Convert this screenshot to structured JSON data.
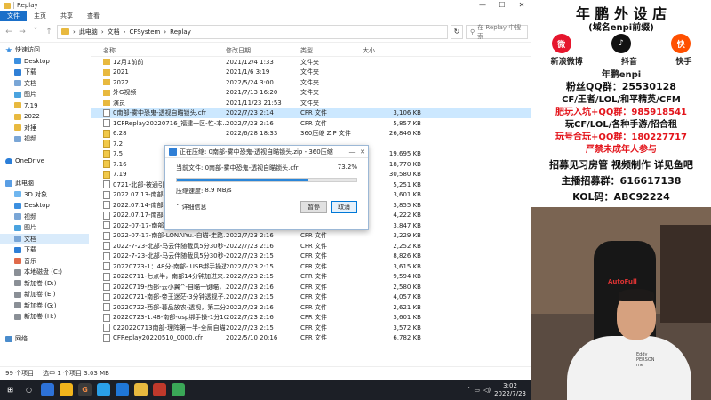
{
  "window": {
    "title": "Replay",
    "controls": [
      "—",
      "☐",
      "✕"
    ]
  },
  "ribbon": {
    "tabs": [
      "文件",
      "主页",
      "共享",
      "查看"
    ]
  },
  "address": {
    "path": [
      "此电脑",
      "文档",
      "CFSystem",
      "Replay"
    ],
    "search_placeholder": "在 Replay 中搜索"
  },
  "nav": [
    {
      "label": "快速访问",
      "icon": "star-icon",
      "indent": 0
    },
    {
      "label": "Desktop",
      "icon": "desktop-icon",
      "indent": 1,
      "pin": true
    },
    {
      "label": "下载",
      "icon": "download-icon",
      "indent": 1,
      "pin": true
    },
    {
      "label": "文档",
      "icon": "document-icon",
      "indent": 1,
      "pin": true
    },
    {
      "label": "图片",
      "icon": "picture-icon",
      "indent": 1,
      "pin": true
    },
    {
      "label": "7.19",
      "icon": "folder-icon",
      "indent": 1
    },
    {
      "label": "2022",
      "icon": "folder-icon",
      "indent": 1
    },
    {
      "label": "对捶",
      "icon": "folder-icon",
      "indent": 1
    },
    {
      "label": "视频",
      "icon": "video-icon",
      "indent": 1
    },
    {
      "label": "",
      "icon": "",
      "indent": 0
    },
    {
      "label": "OneDrive",
      "icon": "cloud-icon",
      "indent": 0
    },
    {
      "label": "",
      "icon": "",
      "indent": 0
    },
    {
      "label": "此电脑",
      "icon": "computer-icon",
      "indent": 0
    },
    {
      "label": "3D 对象",
      "icon": "cube-icon",
      "indent": 1
    },
    {
      "label": "Desktop",
      "icon": "desktop-icon",
      "indent": 1
    },
    {
      "label": "视频",
      "icon": "video-icon",
      "indent": 1
    },
    {
      "label": "图片",
      "icon": "picture-icon",
      "indent": 1
    },
    {
      "label": "文档",
      "icon": "document-icon",
      "indent": 1,
      "selected": true
    },
    {
      "label": "下载",
      "icon": "download-icon",
      "indent": 1
    },
    {
      "label": "音乐",
      "icon": "music-icon",
      "indent": 1
    },
    {
      "label": "本地磁盘 (C:)",
      "icon": "drive-icon",
      "indent": 1
    },
    {
      "label": "新加卷 (D:)",
      "icon": "drive-icon",
      "indent": 1
    },
    {
      "label": "新加卷 (E:)",
      "icon": "drive-icon",
      "indent": 1
    },
    {
      "label": "新加卷 (G:)",
      "icon": "drive-icon",
      "indent": 1
    },
    {
      "label": "新加卷 (H:)",
      "icon": "drive-icon",
      "indent": 1
    },
    {
      "label": "",
      "icon": "",
      "indent": 0
    },
    {
      "label": "网络",
      "icon": "network-icon",
      "indent": 0
    }
  ],
  "columns": {
    "name": "名称",
    "date": "修改日期",
    "type": "类型",
    "size": "大小"
  },
  "files": [
    {
      "name": "12月1前前",
      "date": "2021/12/4 1:33",
      "type": "文件夹",
      "size": "",
      "kind": "folder"
    },
    {
      "name": "2021",
      "date": "2021/1/6 3:19",
      "type": "文件夹",
      "size": "",
      "kind": "folder"
    },
    {
      "name": "2022",
      "date": "2022/5/24 3:00",
      "type": "文件夹",
      "size": "",
      "kind": "folder"
    },
    {
      "name": "外G视频",
      "date": "2021/7/13 16:20",
      "type": "文件夹",
      "size": "",
      "kind": "folder"
    },
    {
      "name": "演员",
      "date": "2021/11/23 21:53",
      "type": "文件夹",
      "size": "",
      "kind": "folder"
    },
    {
      "name": "0南部-雾中恐鬼-透视自瞄锁头.cfr",
      "date": "2022/7/23 2:14",
      "type": "CFR 文件",
      "size": "3,106 KB",
      "kind": "file",
      "selected": true
    },
    {
      "name": "1CFReplay20220716_福建一区-性-本...",
      "date": "2022/7/23 2:16",
      "type": "CFR 文件",
      "size": "5,857 KB",
      "kind": "file"
    },
    {
      "name": "6.28",
      "date": "2022/6/28 18:33",
      "type": "360压缩 ZIP 文件",
      "size": "26,846 KB",
      "kind": "zip"
    },
    {
      "name": "7.2",
      "date": "",
      "type": "",
      "size": "",
      "kind": "zip"
    },
    {
      "name": "7.5",
      "date": "",
      "type": "",
      "size": "19,695 KB",
      "kind": "zip"
    },
    {
      "name": "7.16",
      "date": "",
      "type": "",
      "size": "18,770 KB",
      "kind": "zip"
    },
    {
      "name": "7.19",
      "date": "",
      "type": "",
      "size": "30,580 KB",
      "kind": "zip"
    },
    {
      "name": "0721-北部-被通引领",
      "date": "",
      "type": "",
      "size": "5,251 KB",
      "kind": "file"
    },
    {
      "name": "2022.07.13-南部-理",
      "date": "",
      "type": "",
      "size": "3,601 KB",
      "kind": "file"
    },
    {
      "name": "2022.07.14-南部-蛮",
      "date": "",
      "type": "",
      "size": "3,855 KB",
      "kind": "file"
    },
    {
      "name": "2022.07.17-南部-40",
      "date": "",
      "type": "",
      "size": "4,222 KB",
      "kind": "file"
    },
    {
      "name": "2022-07-17-南部-Breeze-S7-雁-Muka...",
      "date": "2022/7/23 2:16",
      "type": "CFR 文件",
      "size": "3,847 KB",
      "kind": "file"
    },
    {
      "name": "2022-07-17-南部-LONAIYu.-自瞄-走路...",
      "date": "2022/7/23 2:16",
      "type": "CFR 文件",
      "size": "3,229 KB",
      "kind": "file"
    },
    {
      "name": "2022-7-23-北部-马云伴随截风5分30秒-...",
      "date": "2022/7/23 2:16",
      "type": "CFR 文件",
      "size": "2,252 KB",
      "kind": "file"
    },
    {
      "name": "2022-7-23-北部-马云伴随截风5分30秒-...",
      "date": "2022/7/23 2:15",
      "type": "CFR 文件",
      "size": "8,826 KB",
      "kind": "file"
    },
    {
      "name": "20220723-1：48分-南部- USB绑手操透视",
      "date": "2022/7/23 2:15",
      "type": "CFR 文件",
      "size": "3,615 KB",
      "kind": "file"
    },
    {
      "name": "20220711-七点半，南部14分钟加进来...",
      "date": "2022/7/23 2:15",
      "type": "CFR 文件",
      "size": "9,594 KB",
      "kind": "file"
    },
    {
      "name": "20220719-西部-云小翼^-自瞄一键瞄，...",
      "date": "2022/7/23 2:16",
      "type": "CFR 文件",
      "size": "2,580 KB",
      "kind": "file"
    },
    {
      "name": "20220721-南部-帝王迷茫-3分钟透视子...",
      "date": "2022/7/23 2:15",
      "type": "CFR 文件",
      "size": "4,057 KB",
      "kind": "file"
    },
    {
      "name": "20220722-西部-暮品放农-透视，第二分...",
      "date": "2022/7/23 2:16",
      "type": "CFR 文件",
      "size": "2,621 KB",
      "kind": "file"
    },
    {
      "name": "20220723-1.48-南部-usp绑手操-1分10...",
      "date": "2022/7/23 2:16",
      "type": "CFR 文件",
      "size": "3,601 KB",
      "kind": "file"
    },
    {
      "name": "0220220713南部-理阵第一半-全局自瞄...",
      "date": "2022/7/23 2:15",
      "type": "CFR 文件",
      "size": "3,572 KB",
      "kind": "file"
    },
    {
      "name": "CFReplay20220510_0000.cfr",
      "date": "2022/5/10 20:16",
      "type": "CFR 文件",
      "size": "6,782 KB",
      "kind": "file"
    }
  ],
  "status": {
    "count": "99 个项目",
    "selected": "选中 1 个项目  3.03 MB"
  },
  "dialog": {
    "title": "正在压缩: 0南部-雾中恐鬼-透视自瞄锁头.zip - 360压缩",
    "current_label": "当前文件: 0南部-雾中恐鬼-透视自瞄锁头.cfr",
    "percent": "73.2%",
    "progress": 73.2,
    "speed_label": "压缩速度:",
    "speed_value": "8.9 MB/s",
    "details": "详细信息",
    "pause": "暂停",
    "cancel": "取消"
  },
  "taskbar": {
    "time": "3:02",
    "date": "2022/7/23"
  },
  "right_panel": {
    "title": "年 鹏 外 设 店",
    "subtitle": "(域名enpi前缀)",
    "platforms": [
      "新浪微博",
      "抖音",
      "快手"
    ],
    "handle": "年鹏enpi",
    "lines": [
      "粉丝QQ群：25530128",
      "CF/王者/LOL/和平精英/CFM",
      "肥玩入坑+QQ群：985918541",
      "玩CF/LOL/各种手游/招合租",
      "玩号合玩+QQ群：180227717",
      "严禁未成年人参与",
      "招募见习房管 视频制作 详见鱼吧",
      "主播招募群：616617138",
      "KOL码：ABC92224"
    ],
    "chair_brand": "AutoFull",
    "shirt_text": "Eddy PERSON me"
  },
  "colors": {
    "accent": "#1a6fc9",
    "red": "#e3141b",
    "progress": "#2a86d9"
  }
}
